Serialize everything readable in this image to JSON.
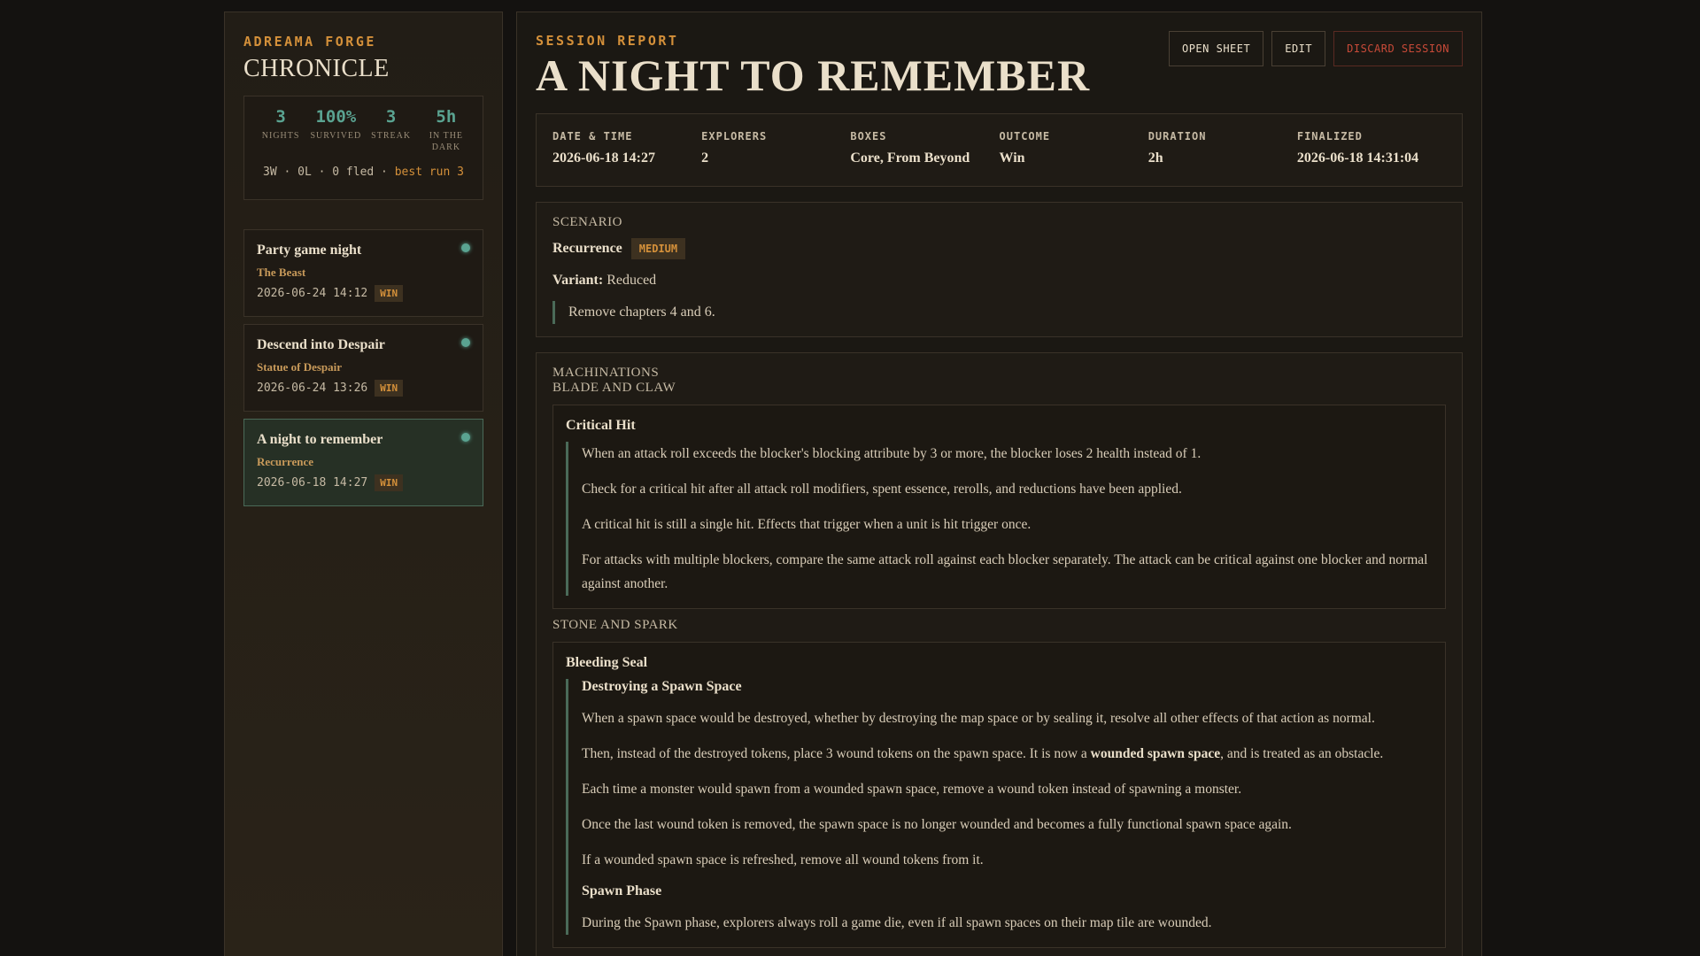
{
  "sidebar": {
    "kicker": "ADREAMA FORGE",
    "title": "CHRONICLE",
    "stats": [
      {
        "value": "3",
        "label": "NIGHTS"
      },
      {
        "value": "100%",
        "label": "SURVIVED"
      },
      {
        "value": "3",
        "label": "STREAK"
      },
      {
        "value": "5h",
        "label": "IN THE DARK"
      }
    ],
    "summary": "3W · 0L · 0 fled · ",
    "summary_best": "best run 3",
    "sessions": [
      {
        "title": "Party game night",
        "subtitle": "The Beast",
        "date": "2026-06-24 14:12",
        "result": "WIN"
      },
      {
        "title": "Descend into Despair",
        "subtitle": "Statue of Despair",
        "date": "2026-06-24 13:26",
        "result": "WIN"
      },
      {
        "title": "A night to remember",
        "subtitle": "Recurrence",
        "date": "2026-06-18 14:27",
        "result": "WIN"
      }
    ]
  },
  "main": {
    "kicker": "SESSION REPORT",
    "title": "A night to remember",
    "toolbar": {
      "open_sheet": "OPEN SHEET",
      "edit": "EDIT",
      "discard": "DISCARD SESSION"
    },
    "meta": [
      {
        "label": "DATE & TIME",
        "value": "2026-06-18 14:27"
      },
      {
        "label": "EXPLORERS",
        "value": "2"
      },
      {
        "label": "BOXES",
        "value": "Core, From Beyond"
      },
      {
        "label": "OUTCOME",
        "value": "Win"
      },
      {
        "label": "DURATION",
        "value": "2h"
      },
      {
        "label": "FINALIZED",
        "value": "2026-06-18 14:31:04"
      }
    ],
    "scenario": {
      "heading": "Scenario",
      "name": "Recurrence",
      "difficulty": "MEDIUM",
      "variant_label": "Variant:",
      "variant_value": "Reduced",
      "note": "Remove chapters 4 and 6."
    },
    "machinations": {
      "heading": "Machinations",
      "group1": "Blade and Claw",
      "critical": {
        "title": "Critical Hit",
        "p1": "When an attack roll exceeds the blocker's blocking attribute by 3 or more, the blocker loses 2 health instead of 1.",
        "p2": "Check for a critical hit after all attack roll modifiers, spent essence, rerolls, and reductions have been applied.",
        "p3": "A critical hit is still a single hit. Effects that trigger when a unit is hit trigger once.",
        "p4": "For attacks with multiple blockers, compare the same attack roll against each blocker separately. The attack can be critical against one blocker and normal against another."
      },
      "group2": "Stone and Spark",
      "bleeding": {
        "title": "Bleeding Seal",
        "sub1": "Destroying a Spawn Space",
        "p1": "When a spawn space would be destroyed, whether by destroying the map space or by sealing it, resolve all other effects of that action as normal.",
        "p2a": "Then, instead of the destroyed tokens, place 3 wound tokens on the spawn space. It is now a ",
        "p2b": "wounded spawn space",
        "p2c": ", and is treated as an obstacle.",
        "p3": "Each time a monster would spawn from a wounded spawn space, remove a wound token instead of spawning a monster.",
        "p4": "Once the last wound token is removed, the spawn space is no longer wounded and becomes a fully functional spawn space again.",
        "p5": "If a wounded spawn space is refreshed, remove all wound tokens from it.",
        "sub2": "Spawn Phase",
        "p6": "During the Spawn phase, explorers always roll a game die, even if all spawn spaces on their map tile are wounded."
      }
    }
  }
}
